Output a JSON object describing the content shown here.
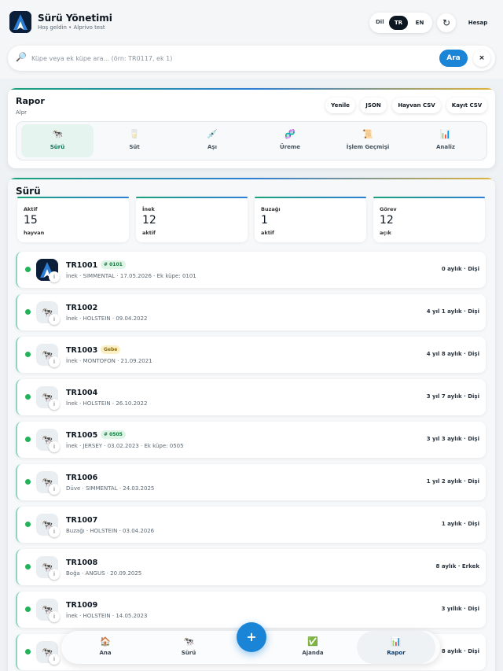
{
  "header": {
    "title": "Sürü Yönetimi",
    "subtitle": "Hoş geldin • Alprivo test",
    "lang_label": "Dil",
    "lang_tr": "TR",
    "lang_en": "EN",
    "refresh_icon": "↻",
    "account_label": "Hesap"
  },
  "search": {
    "placeholder": "Küpe veya ek küpe ara... (örn: TR0117, ek 1)",
    "button_label": "Ara",
    "clear_label": "×",
    "icon": "🔎"
  },
  "report": {
    "title": "Rapor",
    "subtitle": "Alpr",
    "buttons": [
      "Yenile",
      "JSON",
      "Hayvan CSV",
      "Kayıt CSV"
    ],
    "tabs": [
      {
        "label": "Sürü",
        "icon": "🐄",
        "active": true
      },
      {
        "label": "Süt",
        "icon": "🥛",
        "active": false
      },
      {
        "label": "Aşı",
        "icon": "💉",
        "active": false
      },
      {
        "label": "Üreme",
        "icon": "🧬",
        "active": false
      },
      {
        "label": "İşlem Geçmişi",
        "icon": "📜",
        "active": false
      },
      {
        "label": "Analiz",
        "icon": "📊",
        "active": false
      }
    ]
  },
  "herd": {
    "title": "Sürü",
    "stats": [
      {
        "label": "Aktif",
        "value": "15",
        "unit": "hayvan"
      },
      {
        "label": "İnek",
        "value": "12",
        "unit": "aktif"
      },
      {
        "label": "Buzağı",
        "value": "1",
        "unit": "aktif"
      },
      {
        "label": "Görev",
        "value": "12",
        "unit": "açık"
      }
    ],
    "animals": [
      {
        "id": "TR1001",
        "tag": "# 0101",
        "tag_color": "green",
        "detail": "İnek · SIMMENTAL · 17.05.2026 · Ek küpe: 0101",
        "age": "0 aylık · Dişi",
        "logo": true
      },
      {
        "id": "TR1002",
        "tag": "",
        "tag_color": "",
        "detail": "İnek · HOLSTEIN · 09.04.2022",
        "age": "4 yıl 1 aylık · Dişi",
        "logo": false
      },
      {
        "id": "TR1003",
        "tag": "Gebe",
        "tag_color": "yellow",
        "detail": "İnek · MONTOFON · 21.09.2021",
        "age": "4 yıl 8 aylık · Dişi",
        "logo": false
      },
      {
        "id": "TR1004",
        "tag": "",
        "tag_color": "",
        "detail": "İnek · HOLSTEIN · 26.10.2022",
        "age": "3 yıl 7 aylık · Dişi",
        "logo": false
      },
      {
        "id": "TR1005",
        "tag": "# 0505",
        "tag_color": "green",
        "detail": "İnek · JERSEY · 03.02.2023 · Ek küpe: 0505",
        "age": "3 yıl 3 aylık · Dişi",
        "logo": false
      },
      {
        "id": "TR1006",
        "tag": "",
        "tag_color": "",
        "detail": "Düve · SIMMENTAL · 24.03.2025",
        "age": "1 yıl 2 aylık · Dişi",
        "logo": false
      },
      {
        "id": "TR1007",
        "tag": "",
        "tag_color": "",
        "detail": "Buzağı · HOLSTEIN · 03.04.2026",
        "age": "1 aylık · Dişi",
        "logo": false
      },
      {
        "id": "TR1008",
        "tag": "",
        "tag_color": "",
        "detail": "Boğa · ANGUS · 20.09.2025",
        "age": "8 aylık · Erkek",
        "logo": false
      },
      {
        "id": "TR1009",
        "tag": "",
        "tag_color": "",
        "detail": "İnek · HOLSTEIN · 14.05.2023",
        "age": "3 yıllık · Dişi",
        "logo": false
      },
      {
        "id": "",
        "tag": "",
        "tag_color": "",
        "detail": "",
        "age": "8 aylık · Dişi",
        "logo": false
      }
    ]
  },
  "bottom_nav": {
    "items": [
      {
        "label": "Ana",
        "icon": "🏠",
        "active": false
      },
      {
        "label": "Sürü",
        "icon": "🐄",
        "active": false
      },
      {
        "label": "Ajanda",
        "icon": "✅",
        "active": false
      },
      {
        "label": "Rapor",
        "icon": "📊",
        "active": true
      }
    ],
    "fab_label": "+"
  },
  "colors": {
    "accent": "#1a84d6",
    "active_tab": "#e6f4ef",
    "status_dot": "#22b35a",
    "card_border": "#8fd3c3"
  }
}
